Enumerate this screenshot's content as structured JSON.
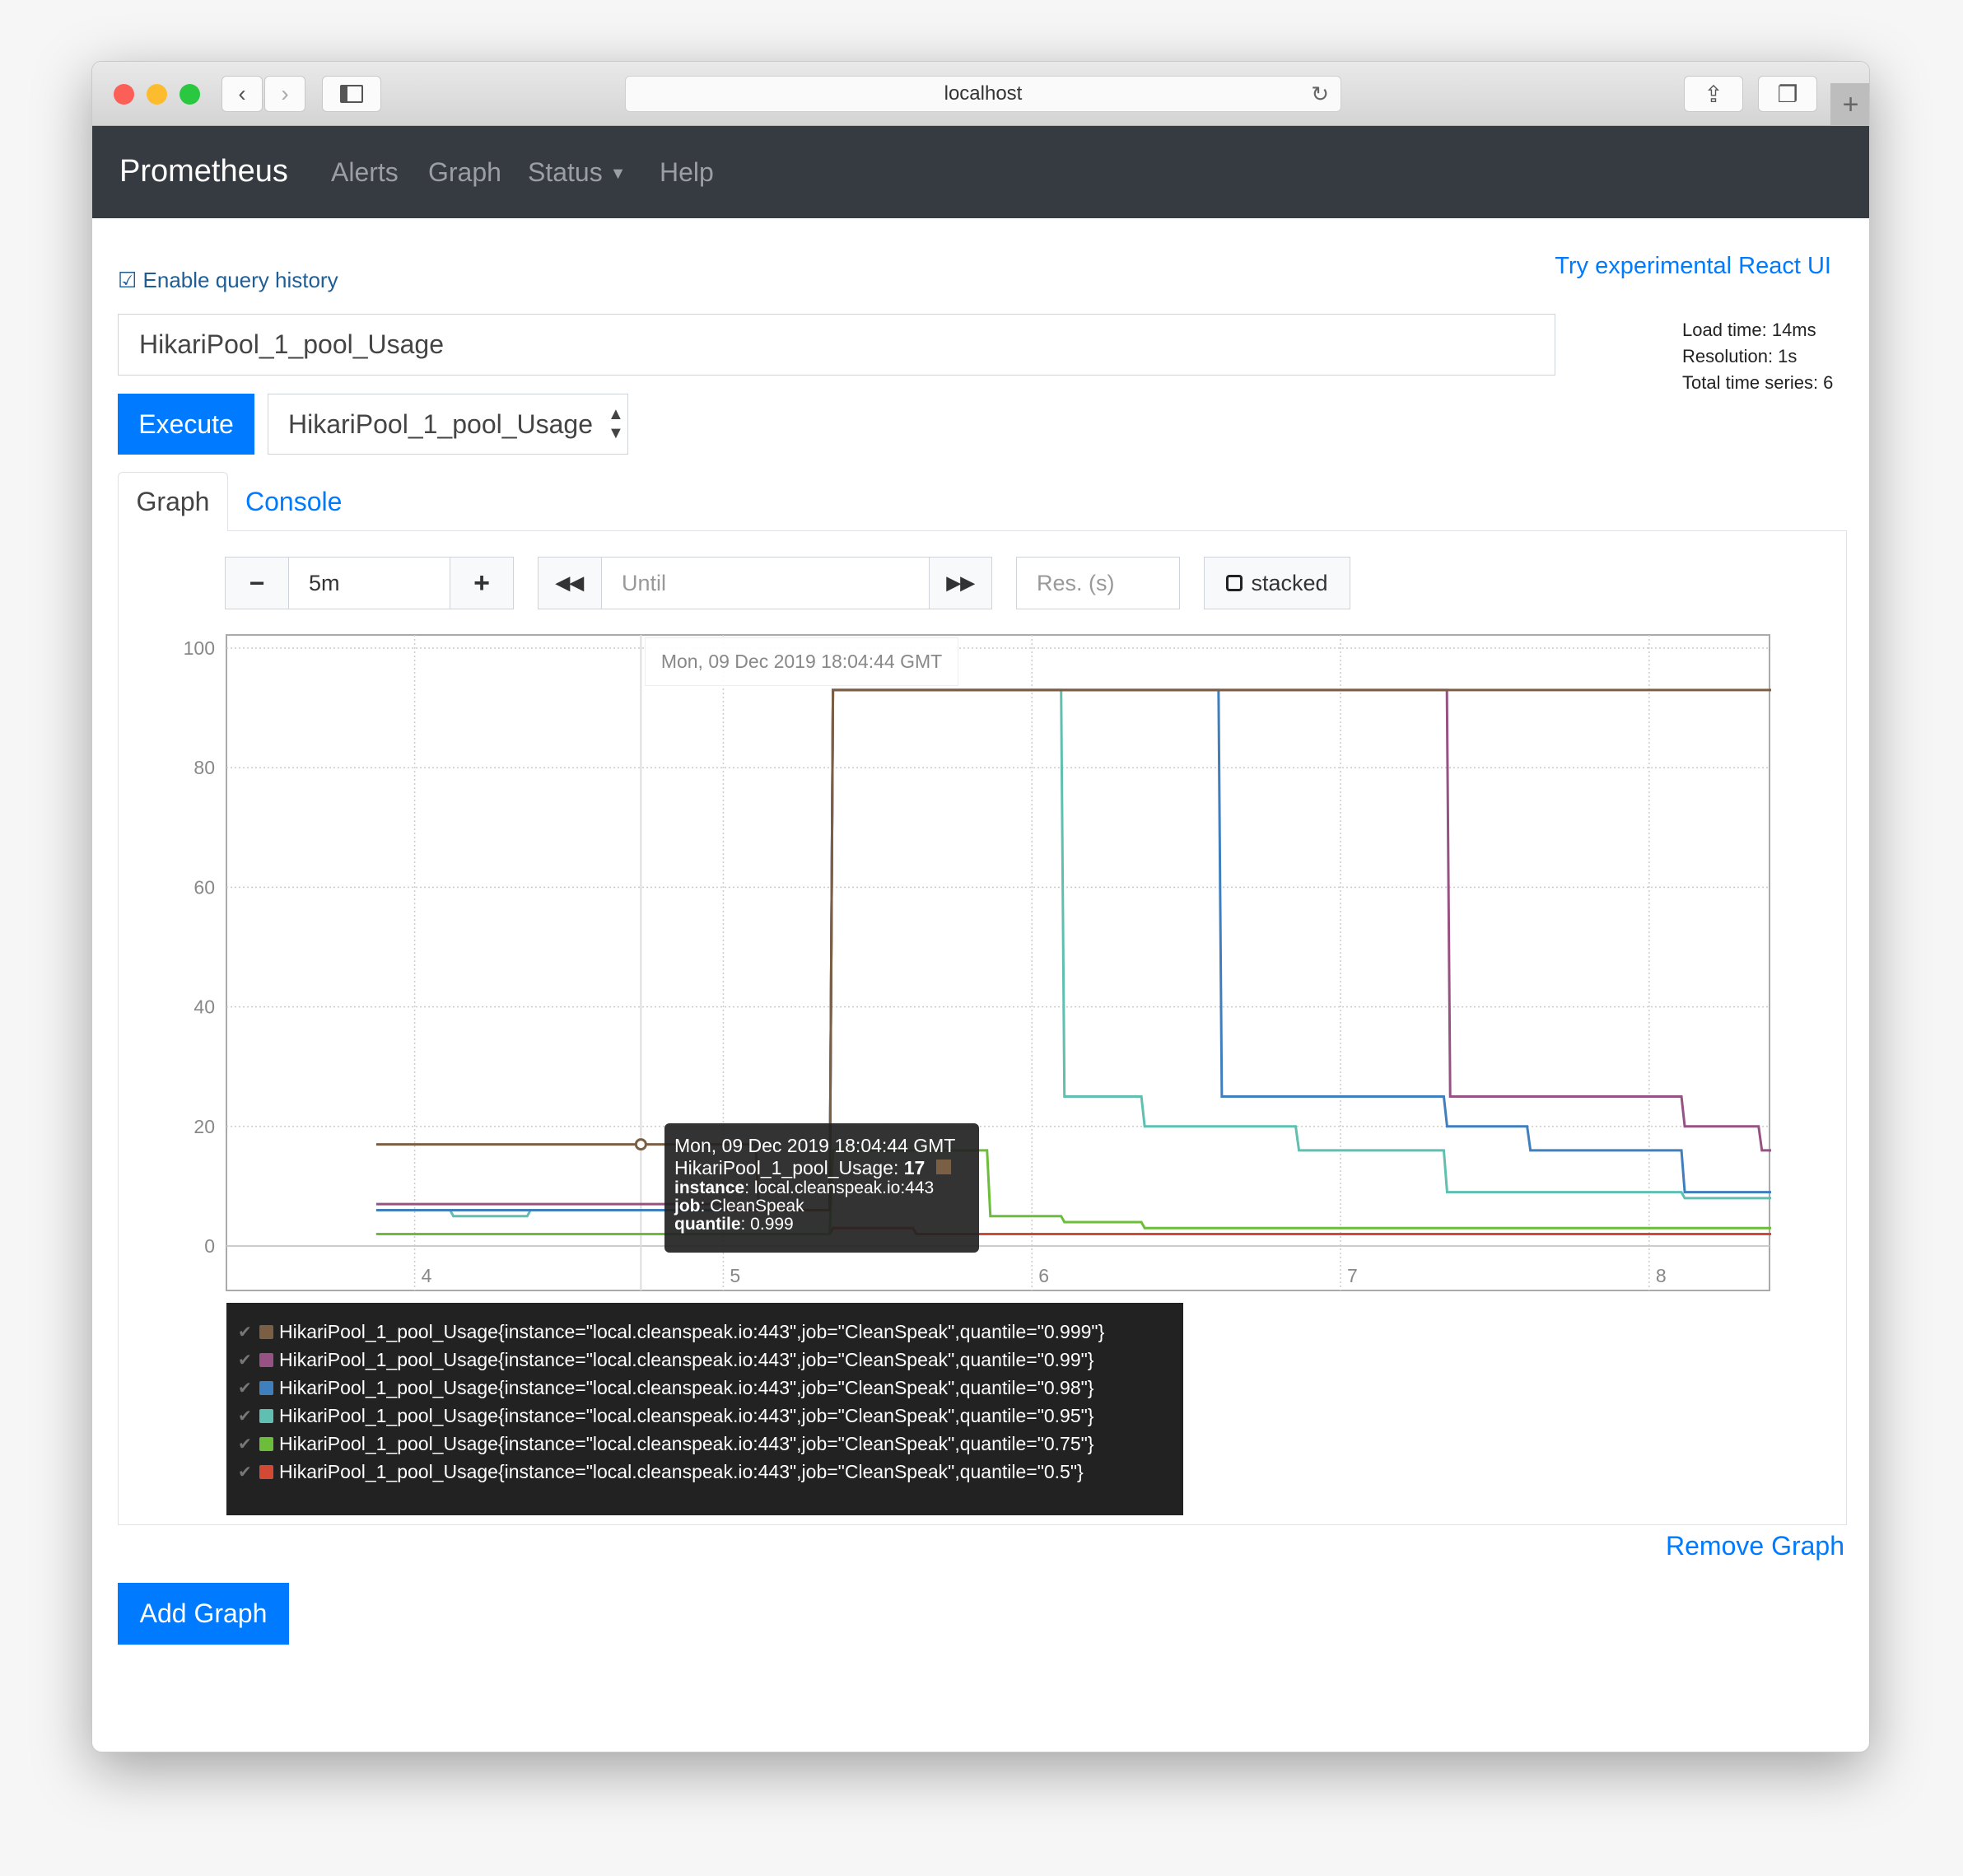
{
  "browser": {
    "url": "localhost"
  },
  "navbar": {
    "brand": "Prometheus",
    "items": [
      "Alerts",
      "Graph",
      "Status",
      "Help"
    ]
  },
  "query_history_label": "Enable query history",
  "react_ui_link": "Try experimental React UI",
  "query": {
    "value": "HikariPool_1_pool_Usage"
  },
  "stats": {
    "load_time": "Load time: 14ms",
    "resolution": "Resolution: 1s",
    "total_series": "Total time series: 6"
  },
  "execute_label": "Execute",
  "metric_select": "HikariPool_1_pool_Usage",
  "tabs": {
    "graph": "Graph",
    "console": "Console"
  },
  "controls": {
    "range": "5m",
    "until_placeholder": "Until",
    "res_placeholder": "Res. (s)",
    "stacked_label": "stacked"
  },
  "hover": {
    "time_label": "Mon, 09 Dec 2019 18:04:44 GMT"
  },
  "tooltip": {
    "time": "Mon, 09 Dec 2019 18:04:44 GMT",
    "metric": "HikariPool_1_pool_Usage: ",
    "value": "17",
    "instance_key": "instance",
    "instance": ": local.cleanspeak.io:443",
    "job_key": "job",
    "job": ": CleanSpeak",
    "quantile_key": "quantile",
    "quantile": ": 0.999"
  },
  "remove_graph": "Remove Graph",
  "add_graph": "Add Graph",
  "chart_data": {
    "type": "line",
    "xlim": [
      3.39,
      8.39
    ],
    "ylim": [
      -7,
      100
    ],
    "x_ticks": [
      4,
      5,
      6,
      7,
      8
    ],
    "x_tick_labels": [
      "4",
      "5",
      "6",
      "7",
      "8"
    ],
    "y_ticks": [
      0,
      20,
      40,
      60,
      80,
      100
    ],
    "y_tick_labels": [
      "0",
      "20",
      "40",
      "60",
      "80",
      "100"
    ],
    "grid": true,
    "legend": "bottom",
    "hover_x": 4.733,
    "series": [
      {
        "name": "HikariPool_1_pool_Usage{instance=\"local.cleanspeak.io:443\",job=\"CleanSpeak\",quantile=\"0.999\"}",
        "color": "#7a5f44",
        "points": [
          [
            3.87,
            17
          ],
          [
            5.11,
            6
          ],
          [
            5.35,
            93
          ],
          [
            8.39,
            93
          ]
        ]
      },
      {
        "name": "HikariPool_1_pool_Usage{instance=\"local.cleanspeak.io:443\",job=\"CleanSpeak\",quantile=\"0.99\"}",
        "color": "#965283",
        "points": [
          [
            3.87,
            7
          ],
          [
            5.0,
            6
          ],
          [
            5.35,
            93
          ],
          [
            7.35,
            25
          ],
          [
            8.11,
            20
          ],
          [
            8.36,
            16
          ],
          [
            8.39,
            16
          ]
        ]
      },
      {
        "name": "HikariPool_1_pool_Usage{instance=\"local.cleanspeak.io:443\",job=\"CleanSpeak\",quantile=\"0.98\"}",
        "color": "#3f7fbd",
        "points": [
          [
            3.87,
            6
          ],
          [
            5.35,
            93
          ],
          [
            6.61,
            25
          ],
          [
            7.34,
            20
          ],
          [
            7.61,
            16
          ],
          [
            8.11,
            9
          ],
          [
            8.39,
            9
          ]
        ]
      },
      {
        "name": "HikariPool_1_pool_Usage{instance=\"local.cleanspeak.io:443\",job=\"CleanSpeak\",quantile=\"0.95\"}",
        "color": "#5fbfb0",
        "points": [
          [
            3.87,
            6
          ],
          [
            4.12,
            5
          ],
          [
            4.37,
            6
          ],
          [
            5.35,
            93
          ],
          [
            6.1,
            25
          ],
          [
            6.36,
            20
          ],
          [
            6.86,
            16
          ],
          [
            7.34,
            9
          ],
          [
            8.11,
            8
          ],
          [
            8.39,
            8
          ]
        ]
      },
      {
        "name": "HikariPool_1_pool_Usage{instance=\"local.cleanspeak.io:443\",job=\"CleanSpeak\",quantile=\"0.75\"}",
        "color": "#6cbe3a",
        "points": [
          [
            3.87,
            2
          ],
          [
            5.35,
            16
          ],
          [
            5.86,
            5
          ],
          [
            6.1,
            4
          ],
          [
            6.36,
            3
          ],
          [
            8.39,
            3
          ]
        ]
      },
      {
        "name": "HikariPool_1_pool_Usage{instance=\"local.cleanspeak.io:443\",job=\"CleanSpeak\",quantile=\"0.5\"}",
        "color": "#d24a36",
        "points": [
          [
            3.87,
            2
          ],
          [
            5.35,
            3
          ],
          [
            5.62,
            2
          ],
          [
            8.39,
            2
          ]
        ]
      }
    ]
  }
}
